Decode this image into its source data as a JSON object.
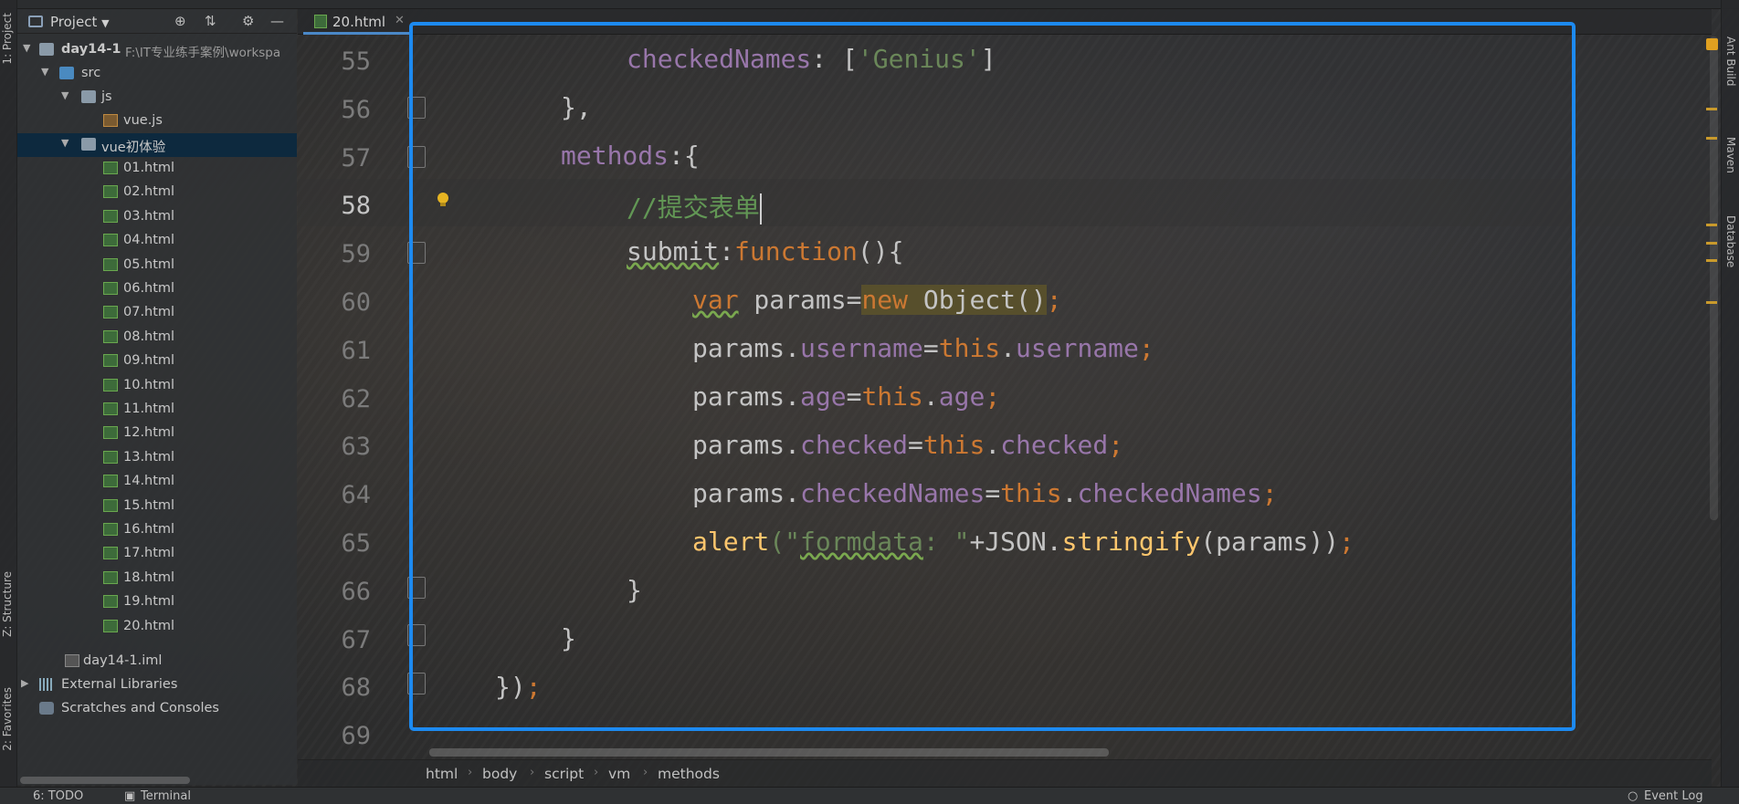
{
  "left_strip": {
    "project_label": "1: Project",
    "structure_label": "Z: Structure",
    "favorites_label": "2: Favorites"
  },
  "right_strip": {
    "ant_label": "Ant Build",
    "maven_label": "Maven",
    "database_label": "Database"
  },
  "project_panel": {
    "title": "Project",
    "tree": {
      "root": {
        "name": "day14-1",
        "path": "F:\\IT专业练手案例\\workspa"
      },
      "src": "src",
      "js": "js",
      "vue_js": "vue.js",
      "vue_folder": "vue初体验",
      "files": [
        "01.html",
        "02.html",
        "03.html",
        "04.html",
        "05.html",
        "06.html",
        "07.html",
        "08.html",
        "09.html",
        "10.html",
        "11.html",
        "12.html",
        "13.html",
        "14.html",
        "15.html",
        "16.html",
        "17.html",
        "18.html",
        "19.html",
        "20.html"
      ],
      "iml": "day14-1.iml",
      "ext_libs": "External Libraries",
      "scratches": "Scratches and Consoles"
    }
  },
  "editor": {
    "active_tab": "20.html",
    "line_numbers": [
      "55",
      "56",
      "57",
      "58",
      "59",
      "60",
      "61",
      "62",
      "63",
      "64",
      "65",
      "66",
      "67",
      "68",
      "69"
    ],
    "current_line": "58",
    "code": {
      "l55_a": "checkedNames",
      "l55_b": ": [",
      "l55_c": "'Genius'",
      "l55_d": "]",
      "l56": "},",
      "l57_a": "methods",
      "l57_b": ":{",
      "l58": "//提交表单",
      "l59_a": "submit",
      "l59_b": ":",
      "l59_c": "function",
      "l59_d": "(){",
      "l60_a": "var",
      "l60_b": " params=",
      "l60_c": "new",
      "l60_d": " Object()",
      "l60_e": ";",
      "l61_a": "params.",
      "l61_b": "username",
      "l61_c": "=",
      "l61_d": "this",
      "l61_e": ".",
      "l61_f": "username",
      "l61_g": ";",
      "l62_a": "params.",
      "l62_b": "age",
      "l62_c": "=",
      "l62_d": "this",
      "l62_e": ".",
      "l62_f": "age",
      "l62_g": ";",
      "l63_a": "params.",
      "l63_b": "checked",
      "l63_c": "=",
      "l63_d": "this",
      "l63_e": ".",
      "l63_f": "checked",
      "l63_g": ";",
      "l64_a": "params.",
      "l64_b": "checkedNames",
      "l64_c": "=",
      "l64_d": "this",
      "l64_e": ".",
      "l64_f": "checkedNames",
      "l64_g": ";",
      "l65_a": "alert",
      "l65_b": "(\"",
      "l65_c": "formdata",
      "l65_d": ": \"",
      "l65_e": "+JSON.",
      "l65_f": "stringify",
      "l65_g": "(params))",
      "l65_h": ";",
      "l66": "}",
      "l67": "}",
      "l68_a": "})",
      "l68_b": ";"
    }
  },
  "breadcrumb": [
    "html",
    "body",
    "script",
    "vm",
    "methods"
  ],
  "bottom_bar": {
    "todo": "6: TODO",
    "terminal": "Terminal",
    "event_log": "Event Log"
  },
  "colors": {
    "selection_frame": "#1d8af0",
    "keyword": "#cc7832",
    "property": "#9876aa",
    "string": "#6a8759",
    "function": "#ffc66d"
  }
}
